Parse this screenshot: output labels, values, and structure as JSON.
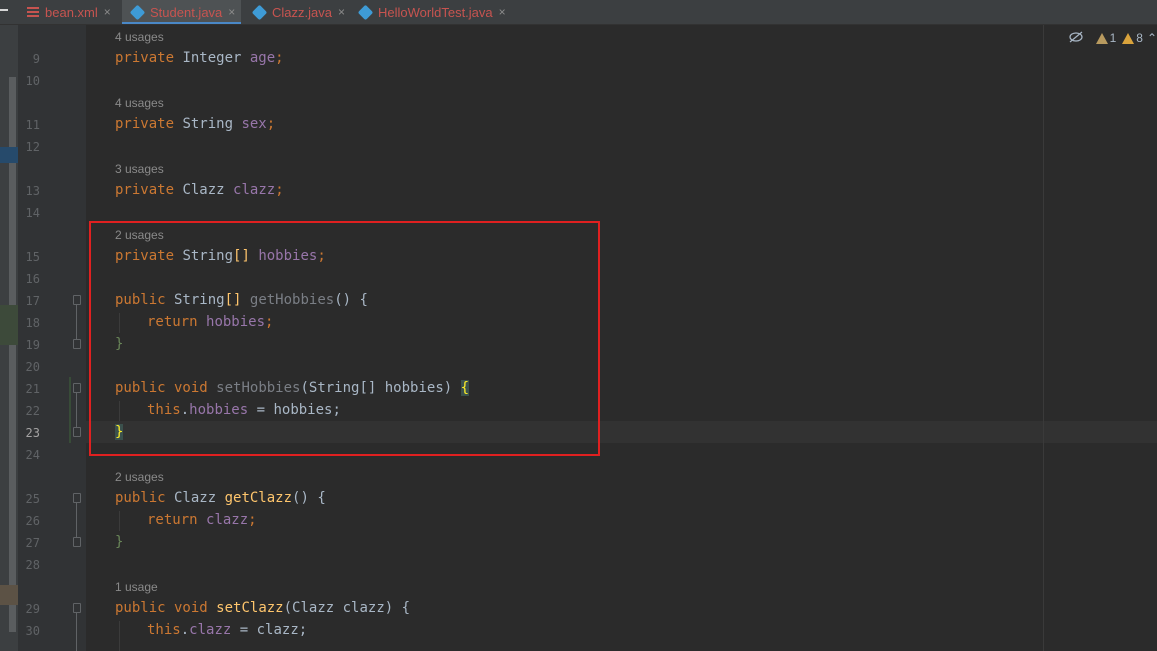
{
  "tabs": [
    {
      "label": "bean.xml",
      "icon": "xml-icon",
      "active": false
    },
    {
      "label": "Student.java",
      "icon": "java-class-icon",
      "active": true
    },
    {
      "label": "Clazz.java",
      "icon": "java-class-icon",
      "active": false
    },
    {
      "label": "HelloWorldTest.java",
      "icon": "java-class-icon",
      "active": false
    }
  ],
  "tab_close_glyph": "×",
  "inspections": {
    "weak_warnings": "1",
    "warnings": "8"
  },
  "line_numbers": [
    "9",
    "10",
    "11",
    "12",
    "13",
    "14",
    "15",
    "16",
    "17",
    "18",
    "19",
    "20",
    "21",
    "22",
    "23",
    "24",
    "25",
    "26",
    "27",
    "28",
    "29",
    "30"
  ],
  "usage_hints": {
    "age": "4 usages",
    "sex": "4 usages",
    "clazz": "3 usages",
    "hobbies": "2 usages",
    "getClazz": "2 usages",
    "setClazz": "1 usage"
  },
  "code": {
    "l9": {
      "k": "private",
      "t": " Integer ",
      "f": "age",
      "p": ";"
    },
    "l11": {
      "k": "private",
      "t": " String ",
      "f": "sex",
      "p": ";"
    },
    "l13": {
      "k": "private",
      "t": " Clazz ",
      "f": "clazz",
      "p": ";"
    },
    "l15": {
      "k": "private",
      "t": " String",
      "b": "[]",
      "sp": " ",
      "f": "hobbies",
      "p": ";"
    },
    "l17": {
      "k": "public",
      "t": " String",
      "b": "[]",
      "sp": " ",
      "m": "getHobbies",
      "p": "() {"
    },
    "l18": {
      "k": "return",
      "sp": " ",
      "f": "hobbies",
      "p": ";"
    },
    "l19": {
      "p": "}"
    },
    "l21": {
      "k": "public",
      "k2": " void",
      "sp": " ",
      "m": "setHobbies",
      "p": "(String[] hobbies) ",
      "b": "{"
    },
    "l22": {
      "k": "this",
      "p1": ".",
      "f": "hobbies",
      "p": " = hobbies;"
    },
    "l23": {
      "b": "}"
    },
    "l25": {
      "k": "public",
      "t": " Clazz ",
      "m": "getClazz",
      "p": "() {"
    },
    "l26": {
      "k": "return",
      "sp": " ",
      "f": "clazz",
      "p": ";"
    },
    "l27": {
      "p": "}"
    },
    "l29": {
      "k": "public",
      "k2": " void",
      "sp": " ",
      "m": "setClazz",
      "p": "(Clazz clazz) {"
    },
    "l30": {
      "k": "this",
      "p1": ".",
      "f": "clazz",
      "p": " = clazz;"
    }
  }
}
